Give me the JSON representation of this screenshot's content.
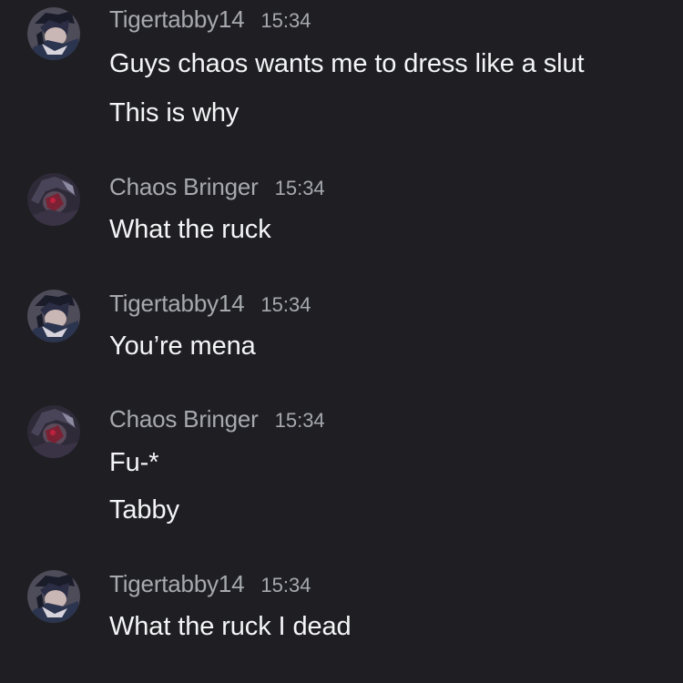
{
  "messages": [
    {
      "username": "Tigertabby14",
      "time": "15:34",
      "avatar_icon": "tigertabby-avatar",
      "lines": [
        "Guys chaos wants me to dress like a slut",
        "This is why"
      ]
    },
    {
      "username": "Chaos Bringer",
      "time": "15:34",
      "avatar_icon": "chaos-bringer-avatar",
      "lines": [
        "What the ruck"
      ]
    },
    {
      "username": "Tigertabby14",
      "time": "15:34",
      "avatar_icon": "tigertabby-avatar",
      "lines": [
        "You’re mena"
      ]
    },
    {
      "username": "Chaos Bringer",
      "time": "15:34",
      "avatar_icon": "chaos-bringer-avatar",
      "lines": [
        "Fu-*",
        "Tabby"
      ]
    },
    {
      "username": "Tigertabby14",
      "time": "15:34",
      "avatar_icon": "tigertabby-avatar",
      "lines": [
        "What the ruck I dead"
      ]
    }
  ],
  "colors": {
    "background": "#1f1f23",
    "username": "#a7a9ae",
    "message_text": "#f4f5f7"
  }
}
